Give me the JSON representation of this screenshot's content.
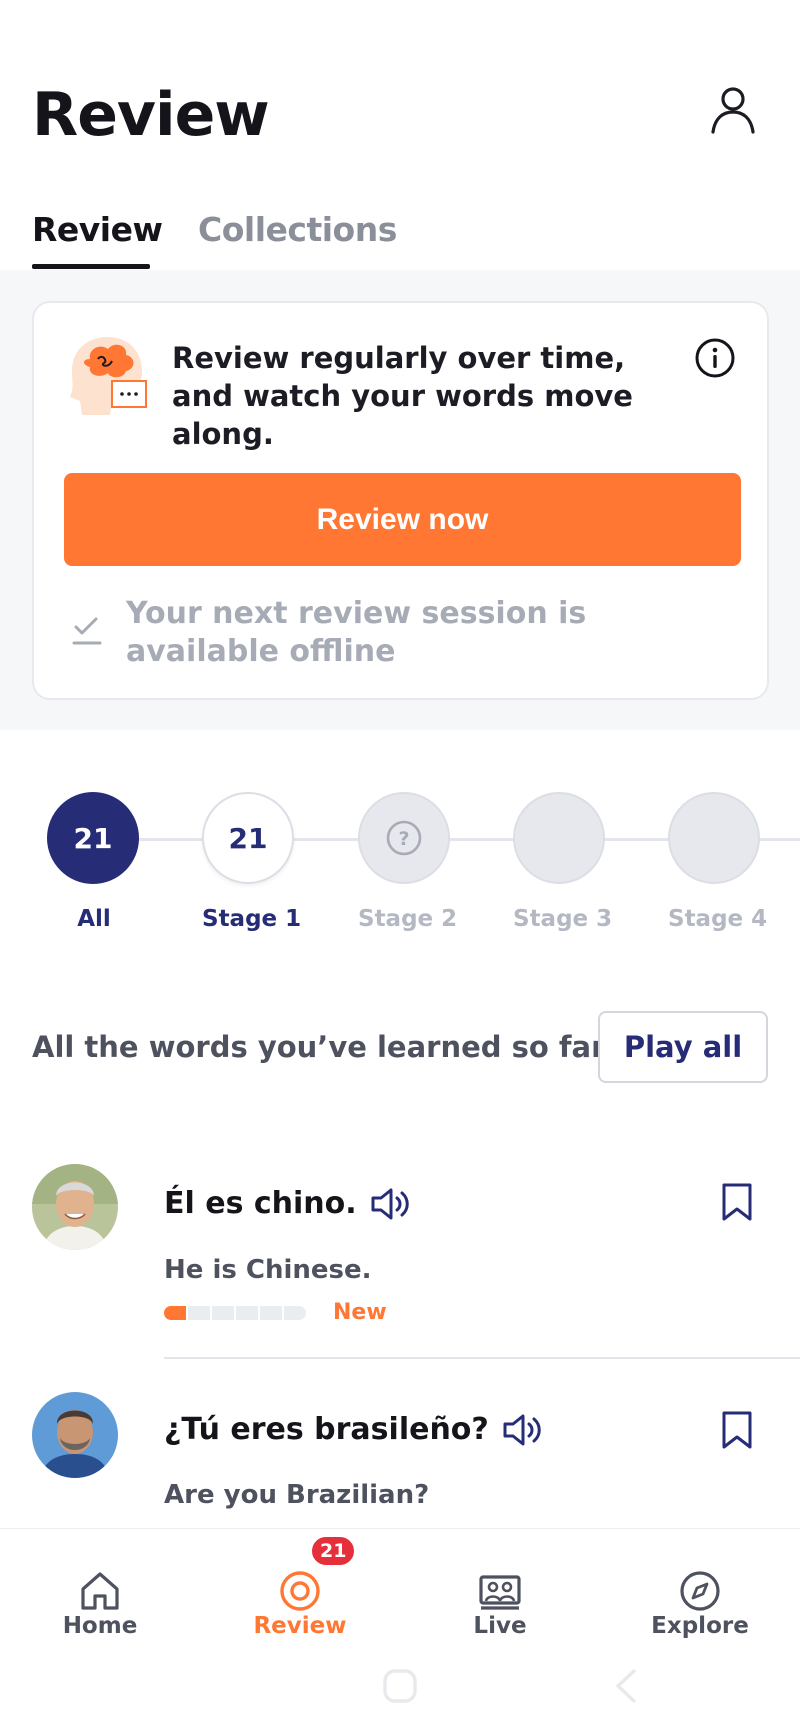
{
  "header": {
    "title": "Review",
    "profile_icon": "person-icon"
  },
  "tabs": [
    {
      "label": "Review",
      "active": true
    },
    {
      "label": "Collections",
      "active": false
    }
  ],
  "info_card": {
    "illustration": "brain-head-icon",
    "message": "Review regularly over time, and watch your words move along.",
    "info_icon": "info-icon",
    "cta_label": "Review now",
    "offline_text": "Your next review session is available offline"
  },
  "stages": [
    {
      "label": "All",
      "value": "21",
      "state": "active"
    },
    {
      "label": "Stage 1",
      "value": "21",
      "state": "available"
    },
    {
      "label": "Stage 2",
      "value": "?",
      "state": "locked"
    },
    {
      "label": "Stage 3",
      "value": "",
      "state": "empty"
    },
    {
      "label": "Stage 4",
      "value": "",
      "state": "empty"
    }
  ],
  "words_section": {
    "description": "All the words you’ve learned so far.",
    "play_all_label": "Play all"
  },
  "words": [
    {
      "phrase": "Él es chino.",
      "translation": "He is Chinese.",
      "status": "New",
      "progress_filled": 1,
      "progress_total": 6
    },
    {
      "phrase": "¿Tú eres brasileño?",
      "translation": "Are you Brazilian?"
    }
  ],
  "bottom_nav": [
    {
      "label": "Home",
      "icon": "home-icon"
    },
    {
      "label": "Review",
      "icon": "target-icon",
      "badge": "21",
      "active": true
    },
    {
      "label": "Live",
      "icon": "video-call-icon"
    },
    {
      "label": "Explore",
      "icon": "compass-icon"
    }
  ],
  "colors": {
    "accent": "#ff7733",
    "navy": "#262c76",
    "badge": "#e5303c"
  }
}
